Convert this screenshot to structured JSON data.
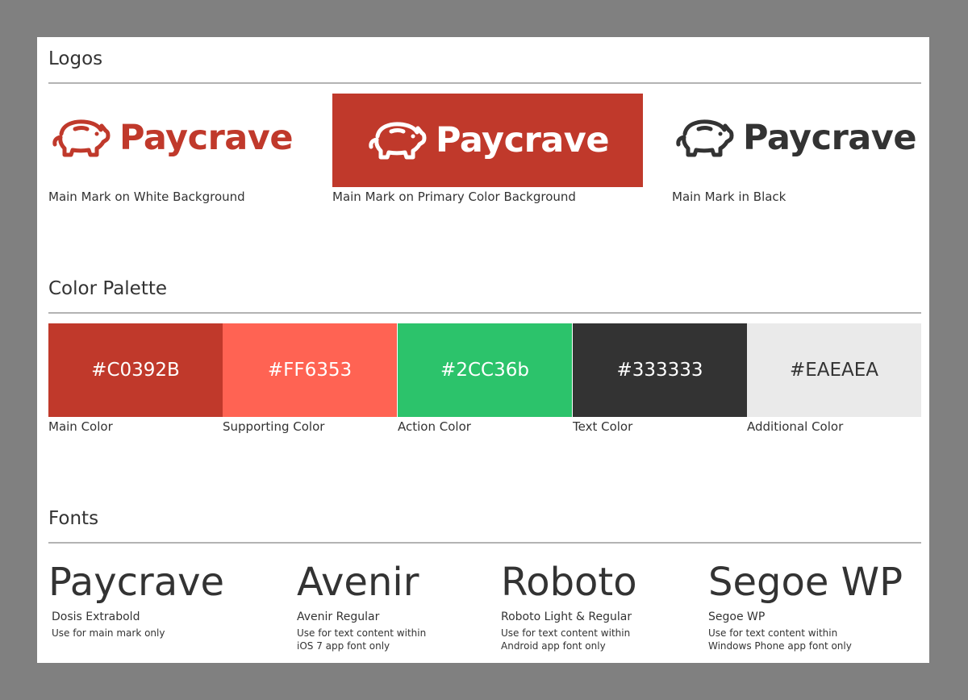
{
  "sections": {
    "logos": "Logos",
    "palette": "Color Palette",
    "fonts": "Fonts"
  },
  "logos": [
    {
      "word": "Paycrave",
      "caption": "Main Mark on White Background",
      "icon": "pig-icon",
      "color": "#C0392B"
    },
    {
      "word": "Paycrave",
      "caption": "Main Mark on Primary Color Background",
      "icon": "pig-icon",
      "color": "#FFFFFF",
      "background": "#C0392B"
    },
    {
      "word": "Paycrave",
      "caption": "Main Mark in Black",
      "icon": "pig-icon",
      "color": "#333333"
    }
  ],
  "palette": [
    {
      "hex": "#C0392B",
      "label": "Main Color",
      "text_color": "#FFFFFF"
    },
    {
      "hex": "#FF6353",
      "label": "Supporting Color",
      "text_color": "#FFFFFF"
    },
    {
      "hex": "#2CC36b",
      "label": "Action Color",
      "text_color": "#FFFFFF"
    },
    {
      "hex": "#333333",
      "label": "Text Color",
      "text_color": "#FFFFFF"
    },
    {
      "hex": "#EAEAEA",
      "label": "Additional Color",
      "text_color": "#333333"
    }
  ],
  "fonts": [
    {
      "sample": "Paycrave",
      "name": "Dosis Extrabold",
      "note1": "Use for main mark only",
      "note2": ""
    },
    {
      "sample": "Avenir",
      "name": "Avenir Regular",
      "note1": "Use for text content within",
      "note2": "iOS 7 app font only"
    },
    {
      "sample": "Roboto",
      "name": "Roboto Light & Regular",
      "note1": "Use for text content within",
      "note2": "Android app font only"
    },
    {
      "sample": "Segoe WP",
      "name": "Segoe WP",
      "note1": "Use for text content within",
      "note2": "Windows Phone app font only"
    }
  ]
}
